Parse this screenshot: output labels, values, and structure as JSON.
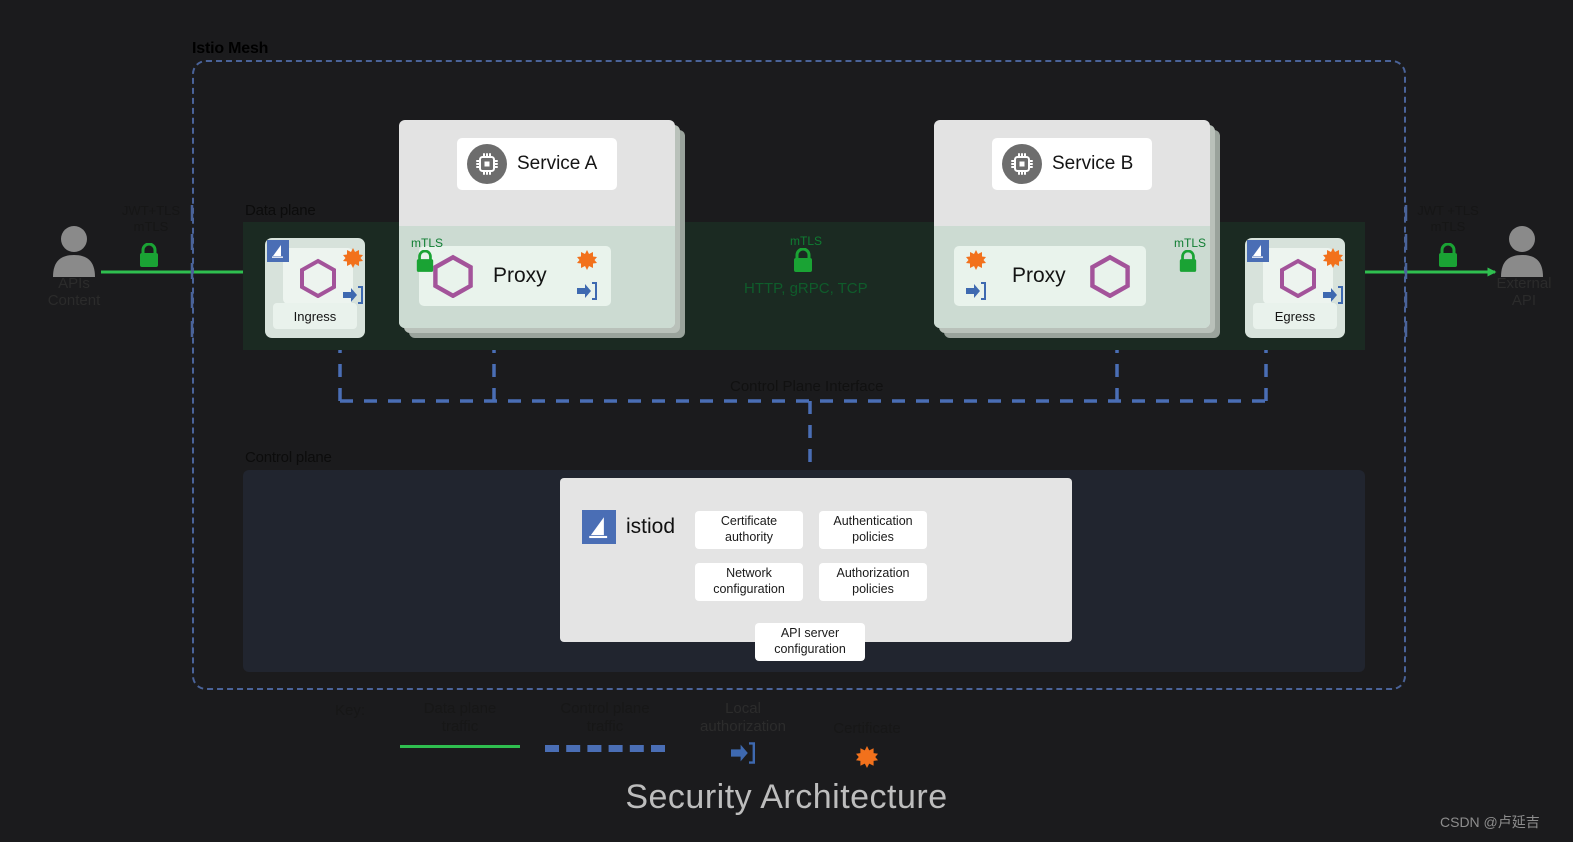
{
  "diagram": {
    "title": "Security Architecture",
    "watermark": "CSDN @卢延吉",
    "mesh_label": "Istio Mesh",
    "regions": {
      "data_plane": "Data plane",
      "control_plane": "Control plane",
      "control_plane_interface": "Control Plane Interface"
    },
    "colors": {
      "page_background": "#1b1b1d",
      "mesh_border": "#4a6399",
      "data_plane_band": "#1b2a22",
      "control_plane_band": "#21252f",
      "data_plane_traffic": "#2fbf4f",
      "control_plane_traffic": "#4a6eb5",
      "certificate": "#f2711c",
      "proxy_hexagon": "#a3539a",
      "istio_blue": "#4a6eb5",
      "lock_green": "#1aa334"
    }
  },
  "actors": {
    "left": {
      "label": "APIs\nContent",
      "line1": "APIs",
      "line2": "Content",
      "icon": "person-icon",
      "edge_label_line1": "JWT+TLS",
      "edge_label_line2": "mTLS",
      "lock_icon": "lock-icon"
    },
    "right": {
      "label": "External\nAPI",
      "line1": "External",
      "line2": "API",
      "icon": "person-icon",
      "edge_label_line1": "JWT +TLS",
      "edge_label_line2": "mTLS",
      "lock_icon": "lock-icon"
    }
  },
  "gateways": {
    "ingress": {
      "label": "Ingress",
      "logo": "istio-sail-icon",
      "hexagon": "hexagon-icon",
      "certificate": "certificate-starburst-icon",
      "authorization": "local-authorization-icon"
    },
    "egress": {
      "label": "Egress",
      "logo": "istio-sail-icon",
      "hexagon": "hexagon-icon",
      "certificate": "certificate-starburst-icon",
      "authorization": "local-authorization-icon"
    }
  },
  "pods": [
    {
      "service_name": "Service A",
      "service_icon": "chip-icon",
      "proxy_name": "Proxy",
      "hexagon": "hexagon-icon",
      "certificate": "certificate-starburst-icon",
      "authorization": "local-authorization-icon",
      "mtls_label": "mTLS",
      "lock_icon": "lock-icon"
    },
    {
      "service_name": "Service B",
      "service_icon": "chip-icon",
      "proxy_name": "Proxy",
      "hexagon": "hexagon-icon",
      "certificate": "certificate-starburst-icon",
      "authorization": "local-authorization-icon",
      "mtls_label": "mTLS",
      "lock_icon": "lock-icon"
    }
  ],
  "middle_link": {
    "mtls_label": "mTLS",
    "lock_icon": "lock-icon",
    "protocols": "HTTP, gRPC, TCP"
  },
  "control_plane": {
    "istiod_label": "istiod",
    "istiod_logo": "istio-sail-icon",
    "tiles": [
      {
        "line1": "Certificate",
        "line2": "authority"
      },
      {
        "line1": "Authentication",
        "line2": "policies"
      },
      {
        "line1": "Network",
        "line2": "configuration"
      },
      {
        "line1": "Authorization",
        "line2": "policies"
      }
    ],
    "api_tile": {
      "line1": "API server",
      "line2": "configuration"
    }
  },
  "key": {
    "word": "Key:",
    "items": [
      {
        "line1": "Data plane",
        "line2": "traffic",
        "glyph": "solid-green-line"
      },
      {
        "line1": "Control plane",
        "line2": "traffic",
        "glyph": "dashed-blue-line"
      },
      {
        "line1": "Local",
        "line2": "authorization",
        "glyph": "local-authorization-icon"
      },
      {
        "line1": "Certificate",
        "line2": "",
        "glyph": "certificate-starburst-icon"
      }
    ]
  }
}
